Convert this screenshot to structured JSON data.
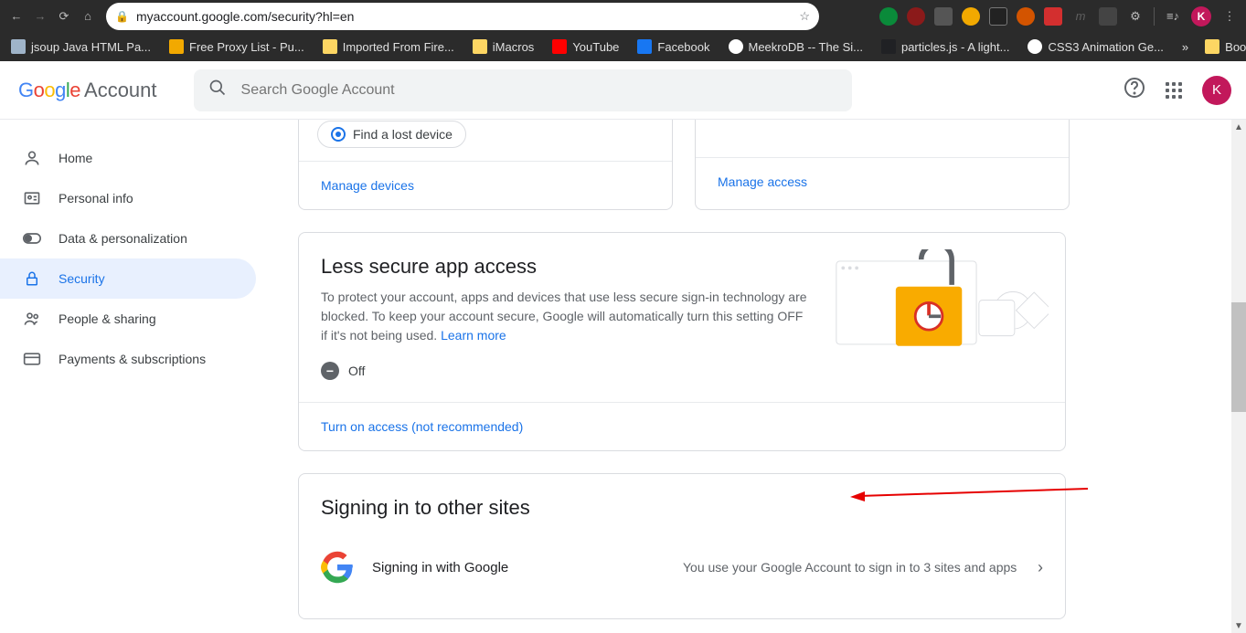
{
  "browser": {
    "url": "myaccount.google.com/security?hl=en",
    "bookmarks": [
      {
        "label": "jsoup Java HTML Pa...",
        "color": "#9fb4c9"
      },
      {
        "label": "Free Proxy List - Pu...",
        "color": "#f2a900"
      },
      {
        "label": "Imported From Fire...",
        "color": "#fdd663"
      },
      {
        "label": "iMacros",
        "color": "#fdd663"
      },
      {
        "label": "YouTube",
        "color": "#ff0000"
      },
      {
        "label": "Facebook",
        "color": "#1877f2"
      },
      {
        "label": "MeekroDB -- The Si...",
        "color": "#ffffff"
      },
      {
        "label": "particles.js - A light...",
        "color": "#202124"
      },
      {
        "label": "CSS3 Animation Ge...",
        "color": "#ffffff"
      }
    ],
    "bm_overflow": "»",
    "bm_last": "Bookmark lain",
    "profile_initial": "K"
  },
  "header": {
    "brand": "Google",
    "account": "Account",
    "search_placeholder": "Search Google Account",
    "avatar_initial": "K"
  },
  "sidebar": {
    "items": [
      {
        "label": "Home"
      },
      {
        "label": "Personal info"
      },
      {
        "label": "Data & personalization"
      },
      {
        "label": "Security"
      },
      {
        "label": "People & sharing"
      },
      {
        "label": "Payments & subscriptions"
      }
    ]
  },
  "devices": {
    "pill": "Find a lost device",
    "manage": "Manage devices",
    "manage_access": "Manage access"
  },
  "lsa": {
    "title": "Less secure app access",
    "desc": "To protect your account, apps and devices that use less secure sign-in technology are blocked. To keep your account secure, Google will automatically turn this setting OFF if it's not being used. ",
    "learn": "Learn more",
    "off": "Off",
    "turn_on": "Turn on access (not recommended)"
  },
  "signin": {
    "title": "Signing in to other sites",
    "row_label": "Signing in with Google",
    "row_sub": "You use your Google Account to sign in to 3 sites and apps"
  }
}
